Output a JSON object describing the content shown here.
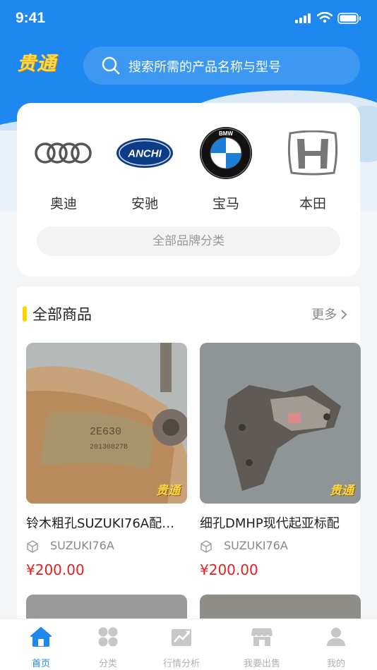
{
  "status_bar": {
    "time": "9:41"
  },
  "header": {
    "logo_text": "贵通",
    "search_placeholder": "搜索所需的产品名称与型号"
  },
  "brands": {
    "items": [
      {
        "name": "奥迪",
        "icon": "audi-logo"
      },
      {
        "name": "安驰",
        "icon": "anchi-logo",
        "logo_text": "ANCHI"
      },
      {
        "name": "宝马",
        "icon": "bmw-logo",
        "logo_text": "BMW"
      },
      {
        "name": "本田",
        "icon": "honda-logo"
      }
    ],
    "all_label": "全部品牌分类"
  },
  "products": {
    "title": "全部商品",
    "more": "更多",
    "items": [
      {
        "title": "铃木粗孔SUZUKI76A配…",
        "model": "SUZUKI76A",
        "price": "¥200.00",
        "watermark": "贵通"
      },
      {
        "title": "细孔DMHP现代起亚标配",
        "model": "SUZUKI76A",
        "price": "¥200.00",
        "watermark": "贵通"
      }
    ]
  },
  "tabbar": {
    "items": [
      {
        "label": "首页",
        "icon": "home-icon",
        "active": true
      },
      {
        "label": "分类",
        "icon": "category-icon",
        "active": false
      },
      {
        "label": "行情分析",
        "icon": "chart-icon",
        "active": false
      },
      {
        "label": "我要出售",
        "icon": "store-icon",
        "active": false
      },
      {
        "label": "我的",
        "icon": "profile-icon",
        "active": false
      }
    ]
  },
  "colors": {
    "primary": "#1e88f0",
    "accent_yellow": "#ffd400",
    "price_red": "#e02020"
  }
}
